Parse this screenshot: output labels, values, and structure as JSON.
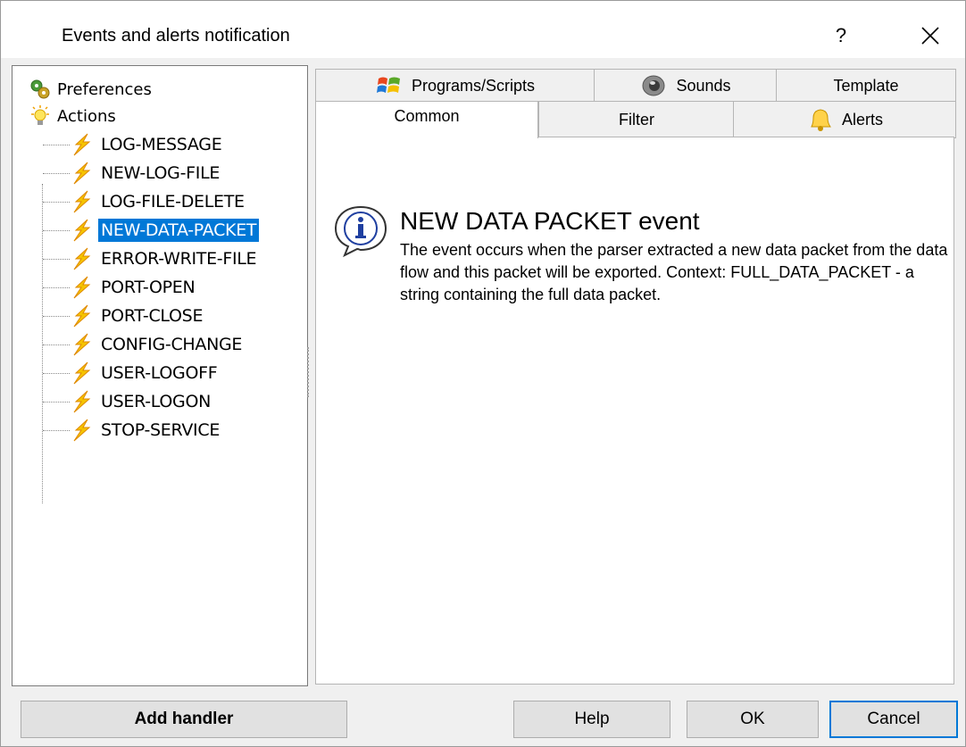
{
  "window": {
    "title": "Events and alerts notification",
    "help_label": "?"
  },
  "tree": {
    "roots": [
      {
        "label": "Preferences",
        "icon": "gears-icon"
      },
      {
        "label": "Actions",
        "icon": "lightbulb-icon"
      }
    ],
    "actions": [
      {
        "label": "LOG-MESSAGE"
      },
      {
        "label": "NEW-LOG-FILE"
      },
      {
        "label": "LOG-FILE-DELETE"
      },
      {
        "label": "NEW-DATA-PACKET",
        "selected": true
      },
      {
        "label": "ERROR-WRITE-FILE"
      },
      {
        "label": "PORT-OPEN"
      },
      {
        "label": "PORT-CLOSE"
      },
      {
        "label": "CONFIG-CHANGE"
      },
      {
        "label": "USER-LOGOFF"
      },
      {
        "label": "USER-LOGON"
      },
      {
        "label": "STOP-SERVICE"
      }
    ]
  },
  "tabs": {
    "row_top": [
      {
        "label": "Programs/Scripts",
        "icon": "windows-flag-icon"
      },
      {
        "label": "Sounds",
        "icon": "speaker-icon"
      },
      {
        "label": "Template"
      }
    ],
    "row_bottom": [
      {
        "label": "Common",
        "active": true
      },
      {
        "label": "Filter"
      },
      {
        "label": "Alerts",
        "icon": "bell-icon"
      }
    ]
  },
  "event": {
    "title": "NEW DATA PACKET event",
    "description": "The event occurs when the parser extracted a new data packet from the data flow and this packet will be exported. Context: FULL_DATA_PACKET - a string containing the full data packet."
  },
  "buttons": {
    "add_handler": "Add handler",
    "help": "Help",
    "ok": "OK",
    "cancel": "Cancel"
  },
  "colors": {
    "selection": "#0078d7",
    "lightning": "#f5c400"
  }
}
